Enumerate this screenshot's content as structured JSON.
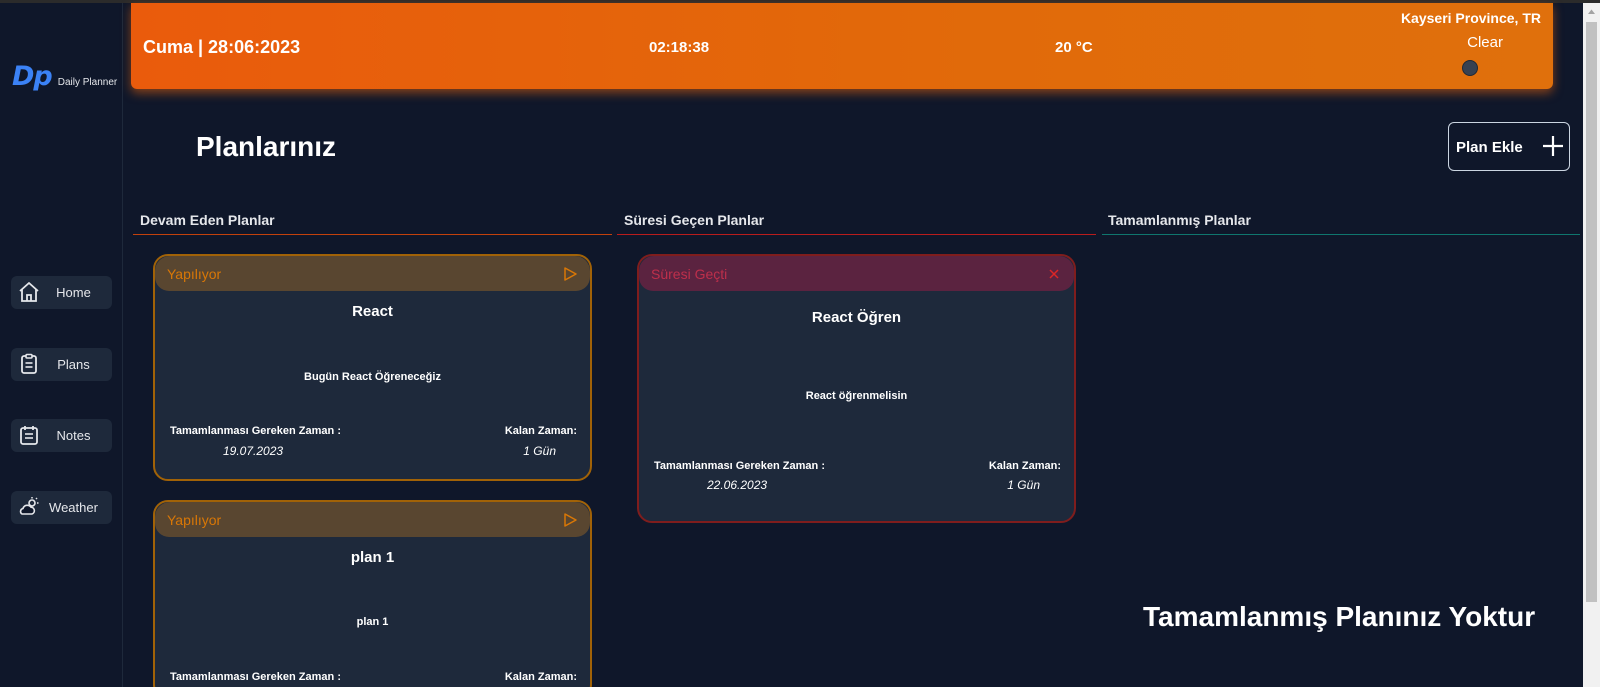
{
  "app": {
    "logo_mark": "Dp",
    "logo_text": "Daily Planner"
  },
  "sidebar": {
    "items": [
      {
        "label": "Home",
        "icon": "home-icon"
      },
      {
        "label": "Plans",
        "icon": "clipboard-icon"
      },
      {
        "label": "Notes",
        "icon": "calendar-notes-icon"
      },
      {
        "label": "Weather",
        "icon": "cloud-sun-icon"
      }
    ]
  },
  "header": {
    "date": "Cuma | 28:06:2023",
    "time": "02:18:38",
    "temperature": "20 °C",
    "location": "Kayseri Province, TR",
    "condition": "Clear",
    "gradient": [
      "#ea5b0c",
      "#e0700c"
    ]
  },
  "main": {
    "title": "Planlarınız",
    "add_button": "Plan Ekle",
    "columns": [
      {
        "title": "Devam Eden Planlar",
        "color": "#c2410c"
      },
      {
        "title": "Süresi Geçen Planlar",
        "color": "#b91c1c"
      },
      {
        "title": "Tamamlanmış Planlar",
        "color": "#0f766e"
      }
    ],
    "ongoing": [
      {
        "status": "Yapılıyor",
        "title": "React",
        "description": "Bugün React Öğreneceğiz",
        "deadline_label": "Tamamlanması Gereken Zaman :",
        "deadline": "19.07.2023",
        "remaining_label": "Kalan Zaman:",
        "remaining": "1 Gün"
      },
      {
        "status": "Yapılıyor",
        "title": "plan 1",
        "description": "plan 1",
        "deadline_label": "Tamamlanması Gereken Zaman :",
        "remaining_label": "Kalan Zaman:"
      }
    ],
    "expired": [
      {
        "status": "Süresi Geçti",
        "title": "React Öğren",
        "description": "React öğrenmelisin",
        "deadline_label": "Tamamlanması Gereken Zaman :",
        "deadline": "22.06.2023",
        "remaining_label": "Kalan Zaman:",
        "remaining": "1 Gün"
      }
    ],
    "completed_empty": "Tamamlanmış Planınız Yoktur"
  },
  "colors": {
    "background": "#0f172a",
    "card": "#1e293b",
    "logo": "#3b82f6",
    "ongoing_accent": "#d97706",
    "expired_accent": "#be2f4b"
  }
}
